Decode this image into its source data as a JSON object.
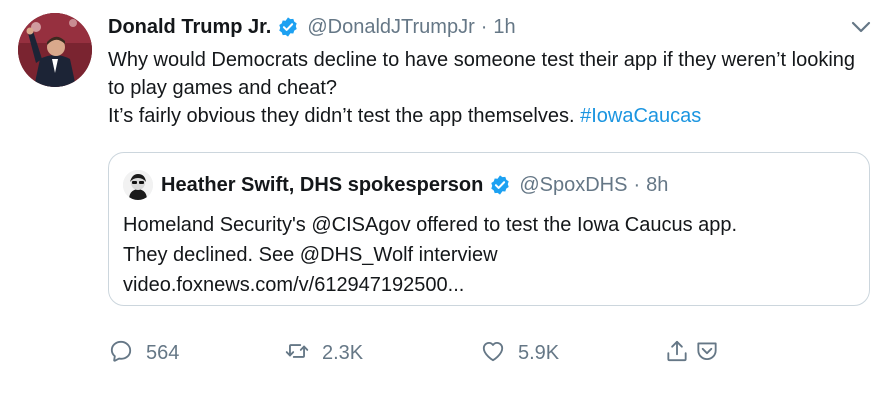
{
  "tweet": {
    "author_name": "Donald Trump Jr.",
    "author_handle": "@DonaldJTrumpJr",
    "separator": "·",
    "time": "1h",
    "text_line1": "Why would Democrats decline to have someone test their app if they weren’t looking to play games and cheat?",
    "text_line2_plain": "It’s fairly obvious they didn’t test the app themselves. ",
    "hashtag": "#IowaCaucas"
  },
  "quoted_tweet": {
    "author_name": "Heather Swift, DHS spokesperson",
    "author_handle": "@SpoxDHS",
    "separator": "·",
    "time": "8h",
    "line1": "Homeland Security's @CISAgov offered to test the Iowa Caucus app.",
    "line2": "They declined.  See @DHS_Wolf interview",
    "line3": "video.foxnews.com/v/612947192500..."
  },
  "actions": {
    "reply_count": "564",
    "retweet_count": "2.3K",
    "like_count": "5.9K"
  },
  "colors": {
    "verified_blue": "#1da1f2",
    "hashtag_blue": "#1b95e0",
    "secondary_text": "#657786",
    "border": "#ccd6dd"
  },
  "icons": {
    "verified": "verified-badge-icon",
    "caret": "chevron-down-icon",
    "reply": "reply-icon",
    "retweet": "retweet-icon",
    "like": "heart-icon",
    "share": "share-icon",
    "save": "pocket-icon"
  }
}
